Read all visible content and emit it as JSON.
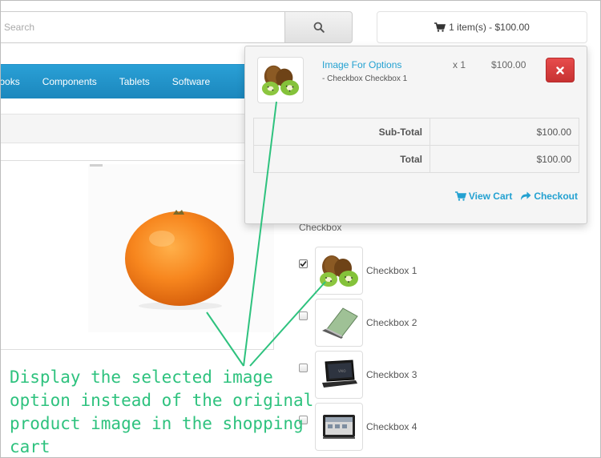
{
  "header": {
    "search_placeholder": "Search",
    "cart_summary": "1 item(s) - $100.00"
  },
  "nav": {
    "items": [
      "Notebooks",
      "Components",
      "Tablets",
      "Software"
    ],
    "visible_labels": [
      "ebooks",
      "Components",
      "Tablets",
      "Software"
    ]
  },
  "cart": {
    "item": {
      "name": "Image For Options",
      "option": "- Checkbox Checkbox 1",
      "qty": "x 1",
      "price": "$100.00"
    },
    "subtotal_label": "Sub-Total",
    "subtotal_value": "$100.00",
    "total_label": "Total",
    "total_value": "$100.00",
    "view_cart_label": "View Cart",
    "checkout_label": "Checkout"
  },
  "options": {
    "group_label": "Checkbox",
    "items": [
      {
        "label": "Checkbox 1",
        "checked": true,
        "image": "kiwi"
      },
      {
        "label": "Checkbox 2",
        "checked": false,
        "image": "green-laptop"
      },
      {
        "label": "Checkbox 3",
        "checked": false,
        "image": "black-laptop"
      },
      {
        "label": "Checkbox 4",
        "checked": false,
        "image": "tablet"
      }
    ]
  },
  "annotation": {
    "text": "Display the selected image option instead of the original product image in the shopping cart"
  },
  "icons": {
    "search": "search-icon",
    "cart": "cart-icon",
    "remove": "close-icon",
    "checkout": "share-arrow-icon"
  },
  "colors": {
    "nav": "#2aa0d6",
    "link": "#23a1d1",
    "danger": "#d9534f",
    "annotation": "#2ec27e"
  }
}
